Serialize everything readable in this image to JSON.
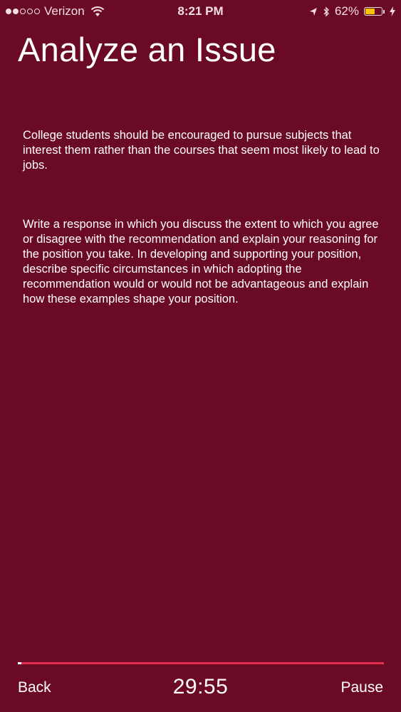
{
  "status_bar": {
    "carrier": "Verizon",
    "time": "8:21 PM",
    "battery": "62%",
    "battery_level": 0.62,
    "signal_bars_filled": 2,
    "signal_bars_total": 5,
    "icons": [
      "wifi-icon",
      "location-arrow-icon",
      "bluetooth-icon",
      "battery-icon",
      "charging-bolt-icon"
    ],
    "battery_color": "#f5c400"
  },
  "page": {
    "title": "Analyze an Issue",
    "prompt": "College students should be encouraged to pursue subjects that interest them rather than the courses that seem most likely to lead to jobs.",
    "instructions": "Write a response in which you discuss the extent to which you agree or disagree with the recommendation and explain your reasoning for the position you take. In developing and supporting your position, describe specific circumstances in which adopting the recommendation would or would not be advantageous and explain how these examples shape your position."
  },
  "timer": {
    "value": "29:55",
    "progress_elapsed": 0.01
  },
  "controls": {
    "back_label": "Back",
    "pause_label": "Pause"
  },
  "colors": {
    "background": "#6b0a25",
    "progress_track": "#e0324f",
    "text": "#ffffff"
  }
}
